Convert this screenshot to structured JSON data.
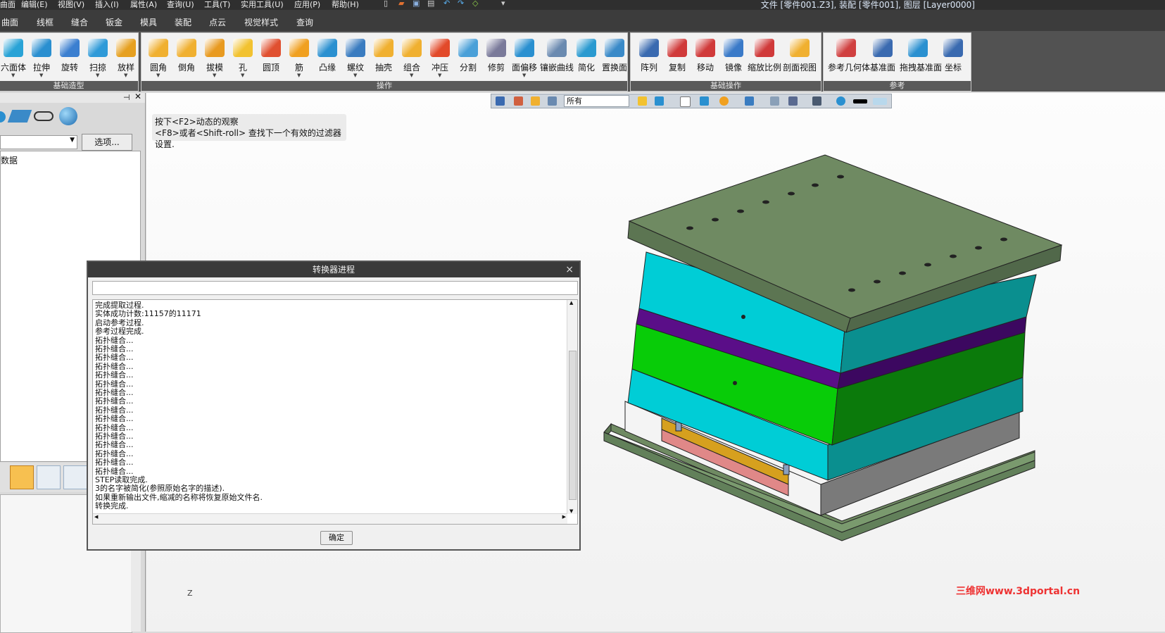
{
  "menubar": {
    "items": [
      "曲面",
      "编辑(E)",
      "视图(V)",
      "插入(I)",
      "属性(A)",
      "查询(U)",
      "工具(T)",
      "实用工具(U)",
      "应用(P)",
      "帮助(H)"
    ],
    "doc_title": "文件 [零件001.Z3], 装配 [零件001], 图层 [Layer0000]"
  },
  "ribbon_tabs": [
    "曲面",
    "线框",
    "缝合",
    "钣金",
    "模具",
    "装配",
    "点云",
    "视觉样式",
    "查询"
  ],
  "ribbon": {
    "groups": [
      {
        "caption": "基础造型",
        "buttons": [
          {
            "label": "六面体",
            "icon": "box-icon",
            "color": "#29a3d6"
          },
          {
            "label": "拉伸",
            "icon": "extrude-icon",
            "color": "#2a8fd0"
          },
          {
            "label": "旋转",
            "icon": "revolve-icon",
            "color": "#3b7fd0"
          },
          {
            "label": "扫掠",
            "icon": "sweep-icon",
            "color": "#2f9ad8"
          },
          {
            "label": "放样",
            "icon": "loft-icon",
            "color": "#e6a020"
          }
        ]
      },
      {
        "caption": "操作",
        "buttons": [
          {
            "label": "圆角",
            "icon": "fillet-icon",
            "color": "#f0b030"
          },
          {
            "label": "倒角",
            "icon": "chamfer-icon",
            "color": "#f0b030"
          },
          {
            "label": "拔模",
            "icon": "draft-icon",
            "color": "#e89a20"
          },
          {
            "label": "孔",
            "icon": "hole-icon",
            "color": "#f2c230"
          },
          {
            "label": "圆顶",
            "icon": "dome-icon",
            "color": "#e05030"
          },
          {
            "label": "筋",
            "icon": "rib-icon",
            "color": "#f0a020"
          },
          {
            "label": "凸缘",
            "icon": "lip-icon",
            "color": "#2a90d0"
          },
          {
            "label": "螺纹",
            "icon": "thread-icon",
            "color": "#3a7cc0"
          },
          {
            "label": "抽壳",
            "icon": "shell-icon",
            "color": "#f0b030"
          },
          {
            "label": "组合",
            "icon": "combine-icon",
            "color": "#f0b030"
          },
          {
            "label": "冲压",
            "icon": "emboss-icon",
            "color": "#e24a2a"
          },
          {
            "label": "分割",
            "icon": "split-icon",
            "color": "#4aa0d8"
          },
          {
            "label": "修剪",
            "icon": "trim-icon",
            "color": "#7a7a9a"
          },
          {
            "label": "面偏移",
            "icon": "face-offset-icon",
            "color": "#2a90d0"
          },
          {
            "label": "镶嵌曲线",
            "icon": "inlay-curve-icon",
            "color": "#6a8ab0"
          },
          {
            "label": "简化",
            "icon": "simplify-icon",
            "color": "#2a9ad0"
          },
          {
            "label": "置换面",
            "icon": "replace-face-icon",
            "color": "#3a8ac8"
          }
        ]
      },
      {
        "caption": "基础操作",
        "buttons": [
          {
            "label": "阵列",
            "icon": "pattern-icon",
            "color": "#3a6ab0"
          },
          {
            "label": "复制",
            "icon": "copy-icon",
            "color": "#d03a3a"
          },
          {
            "label": "移动",
            "icon": "move-icon",
            "color": "#d03a3a"
          },
          {
            "label": "镜像",
            "icon": "mirror-icon",
            "color": "#3a7ac8"
          },
          {
            "label": "缩放比例",
            "icon": "scale-icon",
            "color": "#d03a3a"
          },
          {
            "label": "剖面视图",
            "icon": "section-view-icon",
            "color": "#f0b030"
          }
        ]
      },
      {
        "caption": "参考",
        "buttons": [
          {
            "label": "参考几何体",
            "icon": "ref-geometry-icon",
            "color": "#d04040"
          },
          {
            "label": "基准面",
            "icon": "datum-plane-icon",
            "color": "#3a6ab0"
          },
          {
            "label": "拖拽基准面",
            "icon": "drag-datum-icon",
            "color": "#2a90d0"
          },
          {
            "label": "坐标",
            "icon": "coordinate-icon",
            "color": "#3a6ab0"
          }
        ]
      }
    ]
  },
  "left_panel": {
    "select_value": "",
    "options_button": "选项...",
    "tree_node": "数据"
  },
  "viewport": {
    "filter_value": "所有",
    "hint_line1": "按下<F2>动态的观察",
    "hint_line2": "<F8>或者<Shift-roll> 查找下一个有效的过滤器设置.",
    "axis_label": "Z",
    "watermark": "三维网www.3dportal.cn"
  },
  "dialog": {
    "title": "转换器进程",
    "close": "×",
    "field_value": "",
    "log": [
      "完成提取过程.",
      "实体成功计数:11157的11171",
      "启动参考过程.",
      "参考过程完成.",
      "拓扑缝合...",
      "拓扑缝合...",
      "拓扑缝合...",
      "拓扑缝合...",
      "拓扑缝合...",
      "拓扑缝合...",
      "拓扑缝合...",
      "拓扑缝合...",
      "拓扑缝合...",
      "拓扑缝合...",
      "拓扑缝合...",
      "拓扑缝合...",
      "拓扑缝合...",
      "拓扑缝合...",
      "拓扑缝合...",
      "拓扑缝合...",
      "STEP读取完成.",
      "3的名字被简化(参照原始名字的描述).",
      "如果重新输出文件,缩减的名称将恢复原始文件名.",
      "转换完成."
    ],
    "ok_button": "确定"
  },
  "mold_colors": {
    "top_plate": "#6f8a62",
    "cyan_plate": "#00cdd6",
    "purple_plate": "#5a0e88",
    "green_plate": "#08cc08",
    "base_plate": "#6f8a62",
    "ejector_plate": "#d6a01e",
    "ejector_base": "#e08888"
  }
}
